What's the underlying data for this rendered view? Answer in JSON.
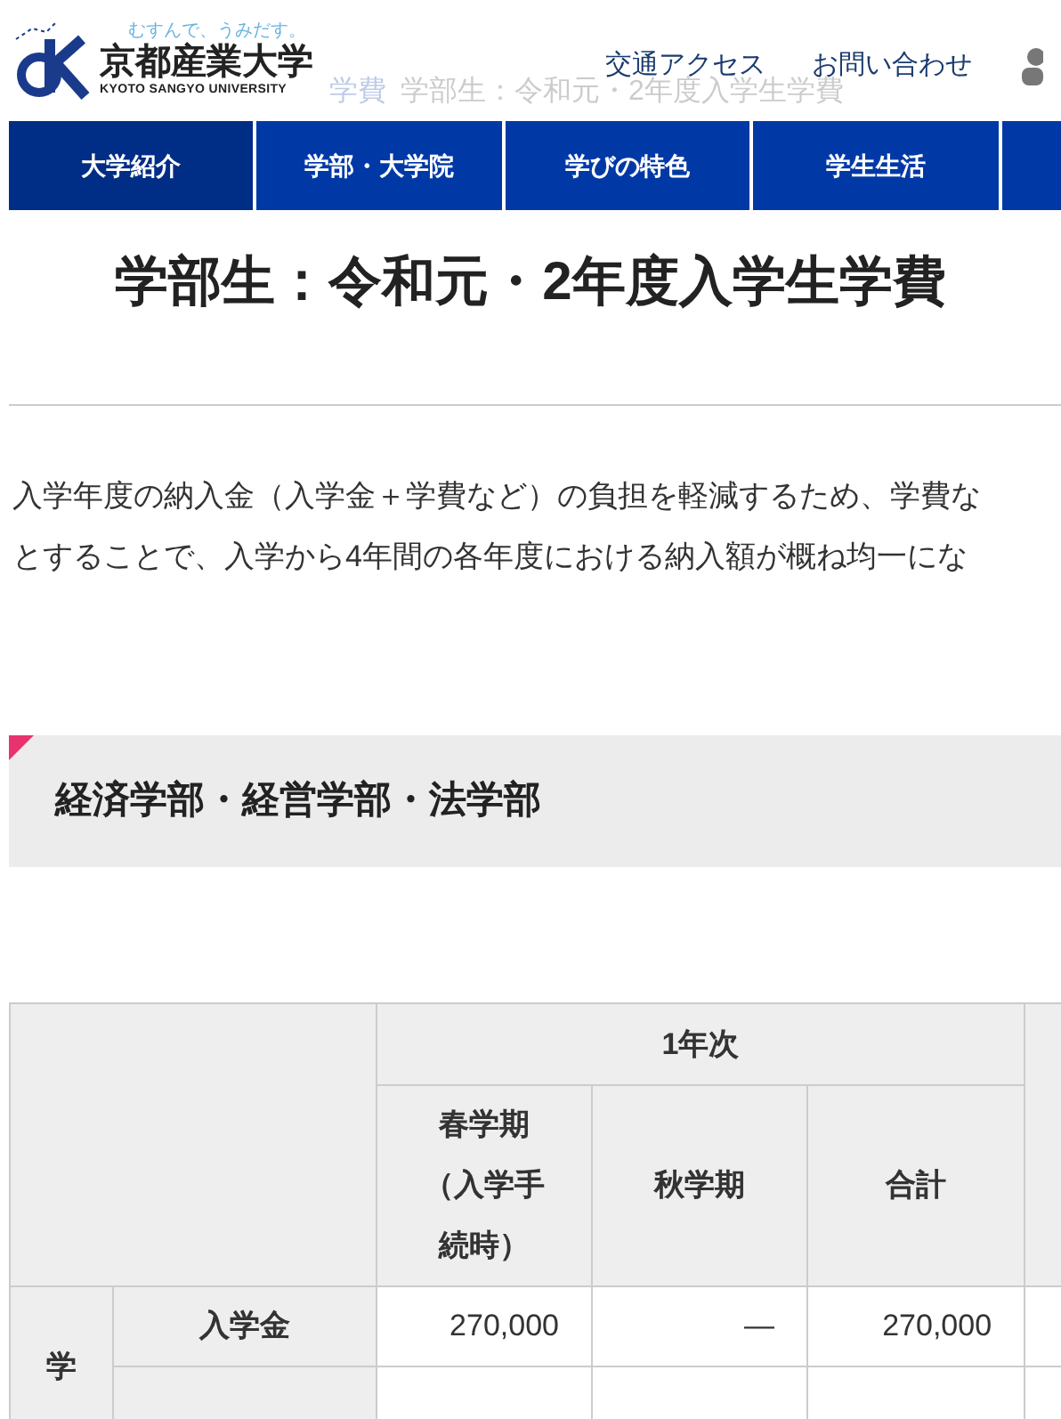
{
  "header": {
    "tagline": "むすんで、うみだす。",
    "logo_name": "京都産業大学",
    "logo_english": "KYOTO SANGYO UNIVERSITY",
    "links": [
      "交通アクセス",
      "お問い合わせ"
    ]
  },
  "breadcrumb": [
    "学費",
    "学部生：令和元・2年度入学生学費"
  ],
  "nav": [
    {
      "label": "大学紹介",
      "selected": true
    },
    {
      "label": "学部・大学院",
      "selected": false
    },
    {
      "label": "学びの特色",
      "selected": false
    },
    {
      "label": "学生生活",
      "selected": false
    }
  ],
  "title": "学部生：令和元・2年度入学生学費",
  "intro": [
    "入学年度の納入金（入学金＋学費など）の負担を軽減するため、学費な",
    "とすることで、入学から4年間の各年度における納入額が概ね均一にな"
  ],
  "section": {
    "heading": "経済学部・経営学部・法学部"
  },
  "table": {
    "year_header": "1年次",
    "columns": [
      "春学期（入学手続時）",
      "秋学期",
      "合計"
    ],
    "group_label": "学",
    "rows": [
      {
        "label": "入学金",
        "values": [
          "270,000",
          "—",
          "270,000"
        ]
      }
    ]
  }
}
